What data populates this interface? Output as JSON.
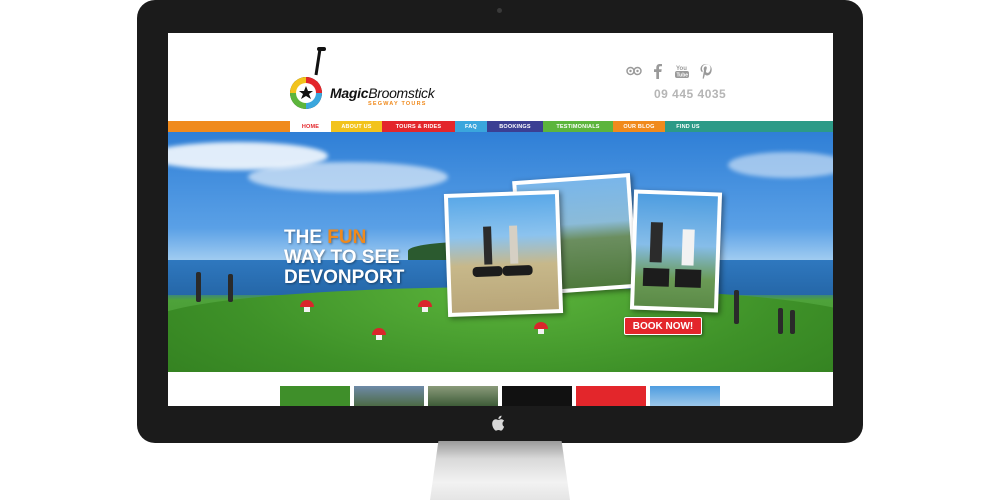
{
  "site": {
    "logo_brand_bold": "Magic",
    "logo_brand_rest": "Broomstick",
    "logo_tagline": "SEGWAY TOURS",
    "phone": "09 445 4035",
    "socials": [
      {
        "icon": "tripadvisor-icon"
      },
      {
        "icon": "facebook-icon"
      },
      {
        "icon": "youtube-icon"
      },
      {
        "icon": "pinterest-icon"
      }
    ]
  },
  "nav": {
    "items": [
      {
        "label": "HOME",
        "color": "#ffffff",
        "text_color": "#e3262b"
      },
      {
        "label": "ABOUT US",
        "color": "#f2c31c"
      },
      {
        "label": "TOURS & RIDES",
        "color": "#e3262b"
      },
      {
        "label": "FAQ",
        "color": "#3aa6dd"
      },
      {
        "label": "BOOKINGS",
        "color": "#3b3f93"
      },
      {
        "label": "TESTIMONIALS",
        "color": "#5cb53c"
      },
      {
        "label": "OUR BLOG",
        "color": "#f08a1c"
      },
      {
        "label": "FIND US",
        "color": "#2c9a87"
      }
    ]
  },
  "hero": {
    "line1_a": "THE ",
    "line1_b": "FUN",
    "line2": "WAY TO SEE",
    "line3": "DEVONPORT",
    "cta": "BOOK NOW!"
  },
  "colors": {
    "accent_orange": "#f08a1c",
    "cta_red": "#e3262b"
  }
}
